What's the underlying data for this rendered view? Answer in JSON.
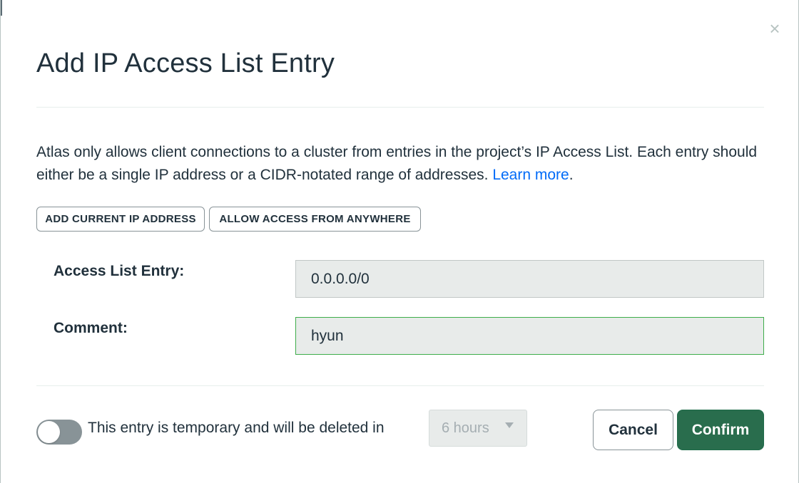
{
  "dialog": {
    "title": "Add IP Access List Entry",
    "close_icon": "×",
    "description": "Atlas only allows client connections to a cluster from entries in the project’s IP Access List. Each entry should either be a single IP address or a CIDR-notated range of addresses.",
    "learn_more": "Learn more",
    "period": "."
  },
  "actions": {
    "add_current_ip": "ADD CURRENT IP ADDRESS",
    "allow_anywhere": "ALLOW ACCESS FROM ANYWHERE"
  },
  "fields": {
    "entry_label": "Access List Entry:",
    "entry_value": "0.0.0.0/0",
    "comment_label": "Comment:",
    "comment_value": "hyun"
  },
  "footer": {
    "temporary_toggle_on": false,
    "temporary_text": "This entry is temporary and will be deleted in",
    "duration_value": "6 hours",
    "cancel_label": "Cancel",
    "confirm_label": "Confirm"
  },
  "colors": {
    "primary_button": "#296d4d",
    "link": "#016bf8",
    "focus_border": "#3dad4a"
  }
}
